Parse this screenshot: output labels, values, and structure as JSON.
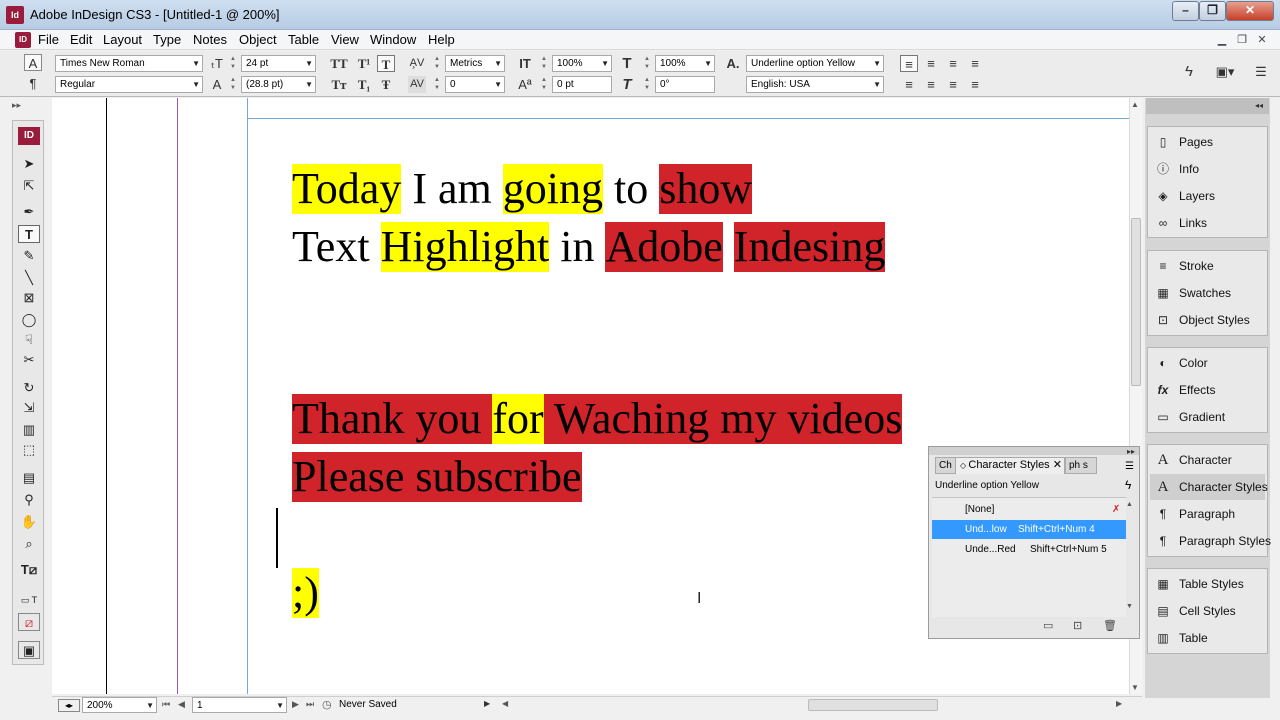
{
  "window": {
    "title": "Adobe InDesign CS3 - [Untitled-1 @ 200%]",
    "app_icon": "Id",
    "min_icon": "minimize-icon",
    "max_icon": "restore-icon",
    "close_icon": "close-icon"
  },
  "menu": [
    "File",
    "Edit",
    "Layout",
    "Type",
    "Notes",
    "Object",
    "Table",
    "View",
    "Window",
    "Help"
  ],
  "control": {
    "font_family": "Times New Roman",
    "font_style": "Regular",
    "font_size": "24 pt",
    "leading": "(28.8 pt)",
    "kerning": "Metrics",
    "tracking": "0",
    "vertical_scale": "100%",
    "baseline_shift": "0 pt",
    "horizontal_scale": "100%",
    "skew": "0°",
    "char_style": "Underline option Yellow",
    "language": "English: USA",
    "tt_icons": [
      "TT",
      "T¹",
      "T",
      "Tт",
      "T₁",
      "Ŧ"
    ]
  },
  "document": {
    "lines": [
      [
        {
          "t": "Today",
          "bg": "yellow"
        },
        {
          "t": " I am ",
          "bg": "none"
        },
        {
          "t": "going",
          "bg": "yellow"
        },
        {
          "t": " to ",
          "bg": "none"
        },
        {
          "t": "show",
          "bg": "red"
        }
      ],
      [
        {
          "t": "Text ",
          "bg": "none"
        },
        {
          "t": "Highlight",
          "bg": "yellow"
        },
        {
          "t": " in ",
          "bg": "none"
        },
        {
          "t": "Adobe",
          "bg": "red"
        },
        {
          "t": " ",
          "bg": "none"
        },
        {
          "t": "Indesing",
          "bg": "red"
        }
      ],
      [
        {
          "t": "Thank you ",
          "bg": "red"
        },
        {
          "t": "for",
          "bg": "yellow"
        },
        {
          "t": " Waching my videos",
          "bg": "red"
        }
      ],
      [
        {
          "t": "Please subscribe",
          "bg": "red"
        }
      ],
      [
        {
          "t": ";)",
          "bg": "yellow"
        }
      ]
    ]
  },
  "colors": {
    "yellow": "#ffff00",
    "red": "#d0232a",
    "selection": "#3399ff",
    "titlebar": "#c4d5e9"
  },
  "panels_dock": [
    [
      "Pages",
      "Info",
      "Layers",
      "Links"
    ],
    [
      "Stroke",
      "Swatches",
      "Object Styles"
    ],
    [
      "Color",
      "Effects",
      "Gradient"
    ],
    [
      "Character",
      "Character Styles",
      "Paragraph",
      "Paragraph Styles"
    ],
    [
      "Table Styles",
      "Cell Styles",
      "Table"
    ]
  ],
  "char_styles_panel": {
    "tabs": [
      "Ch",
      "Character Styles",
      "ph",
      "s"
    ],
    "current": "Underline option Yellow",
    "rows": [
      {
        "name": "[None]",
        "shortcut": ""
      },
      {
        "name": "Und...low",
        "shortcut": "Shift+Ctrl+Num 4"
      },
      {
        "name": "Unde...Red",
        "shortcut": "Shift+Ctrl+Num 5"
      }
    ]
  },
  "status": {
    "zoom": "200%",
    "page": "1",
    "save_state": "Never Saved"
  }
}
